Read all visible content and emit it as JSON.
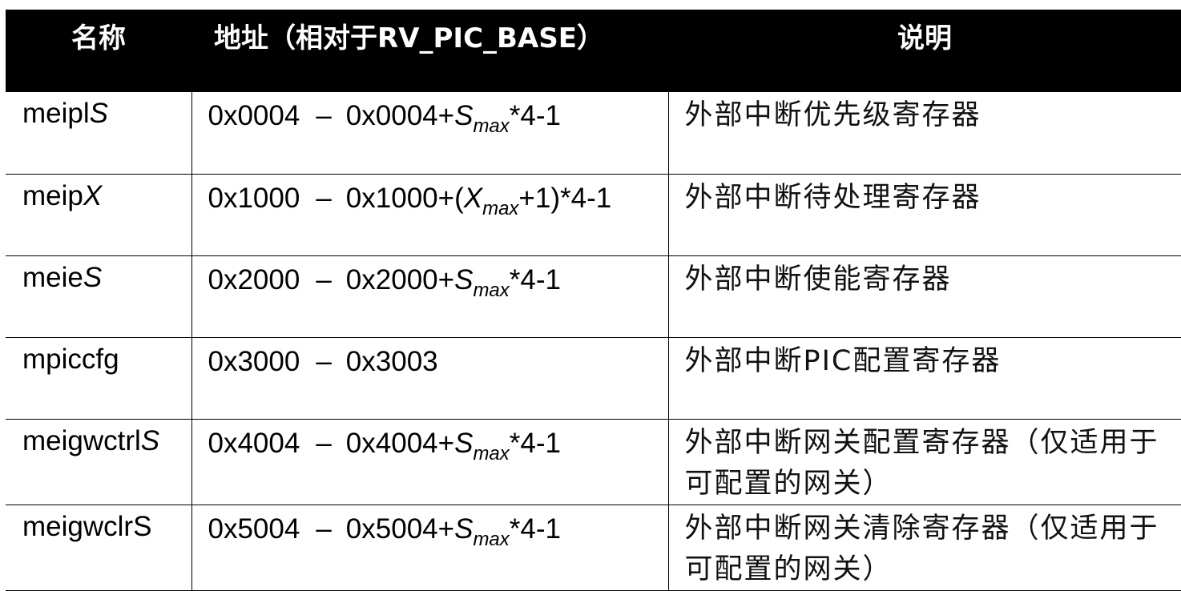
{
  "table": {
    "headers": {
      "name": "名称",
      "address": "地址（相对于RV_PIC_BASE）",
      "description": "说明"
    },
    "rows": [
      {
        "name_prefix": "meipl",
        "name_var": "S",
        "addr_start": "0x0004",
        "addr_dash": "–",
        "addr_pre": "0x0004+",
        "addr_var": "S",
        "addr_sub": "max",
        "addr_post": "*4-1",
        "description": "外部中断优先级寄存器"
      },
      {
        "name_prefix": "meip",
        "name_var": "X",
        "addr_start": "0x1000",
        "addr_dash": "–",
        "addr_pre": "0x1000+(",
        "addr_var": "X",
        "addr_sub": "max",
        "addr_post": "+1)*4-1",
        "description": "外部中断待处理寄存器"
      },
      {
        "name_prefix": "meie",
        "name_var": "S",
        "addr_start": "0x2000",
        "addr_dash": "–",
        "addr_pre": "0x2000+",
        "addr_var": "S",
        "addr_sub": "max",
        "addr_post": "*4-1",
        "description": "外部中断使能寄存器"
      },
      {
        "name_prefix": "mpiccfg",
        "name_var": "",
        "addr_start": "0x3000",
        "addr_dash": "–",
        "addr_pre": "0x3003",
        "addr_var": "",
        "addr_sub": "",
        "addr_post": "",
        "description": "外部中断PIC配置寄存器"
      },
      {
        "name_prefix": "meigwctrl",
        "name_var": "S",
        "addr_start": "0x4004",
        "addr_dash": "–",
        "addr_pre": "0x4004+",
        "addr_var": "S",
        "addr_sub": "max",
        "addr_post": "*4-1",
        "description": "外部中断网关配置寄存器（仅适用于可配置的网关）"
      },
      {
        "name_prefix": "meigwclrS",
        "name_var": "",
        "addr_start": "0x5004",
        "addr_dash": "–",
        "addr_pre": "0x5004+",
        "addr_var": "S",
        "addr_sub": "max",
        "addr_post": "*4-1",
        "description": "外部中断网关清除寄存器（仅适用于可配置的网关）"
      }
    ]
  }
}
